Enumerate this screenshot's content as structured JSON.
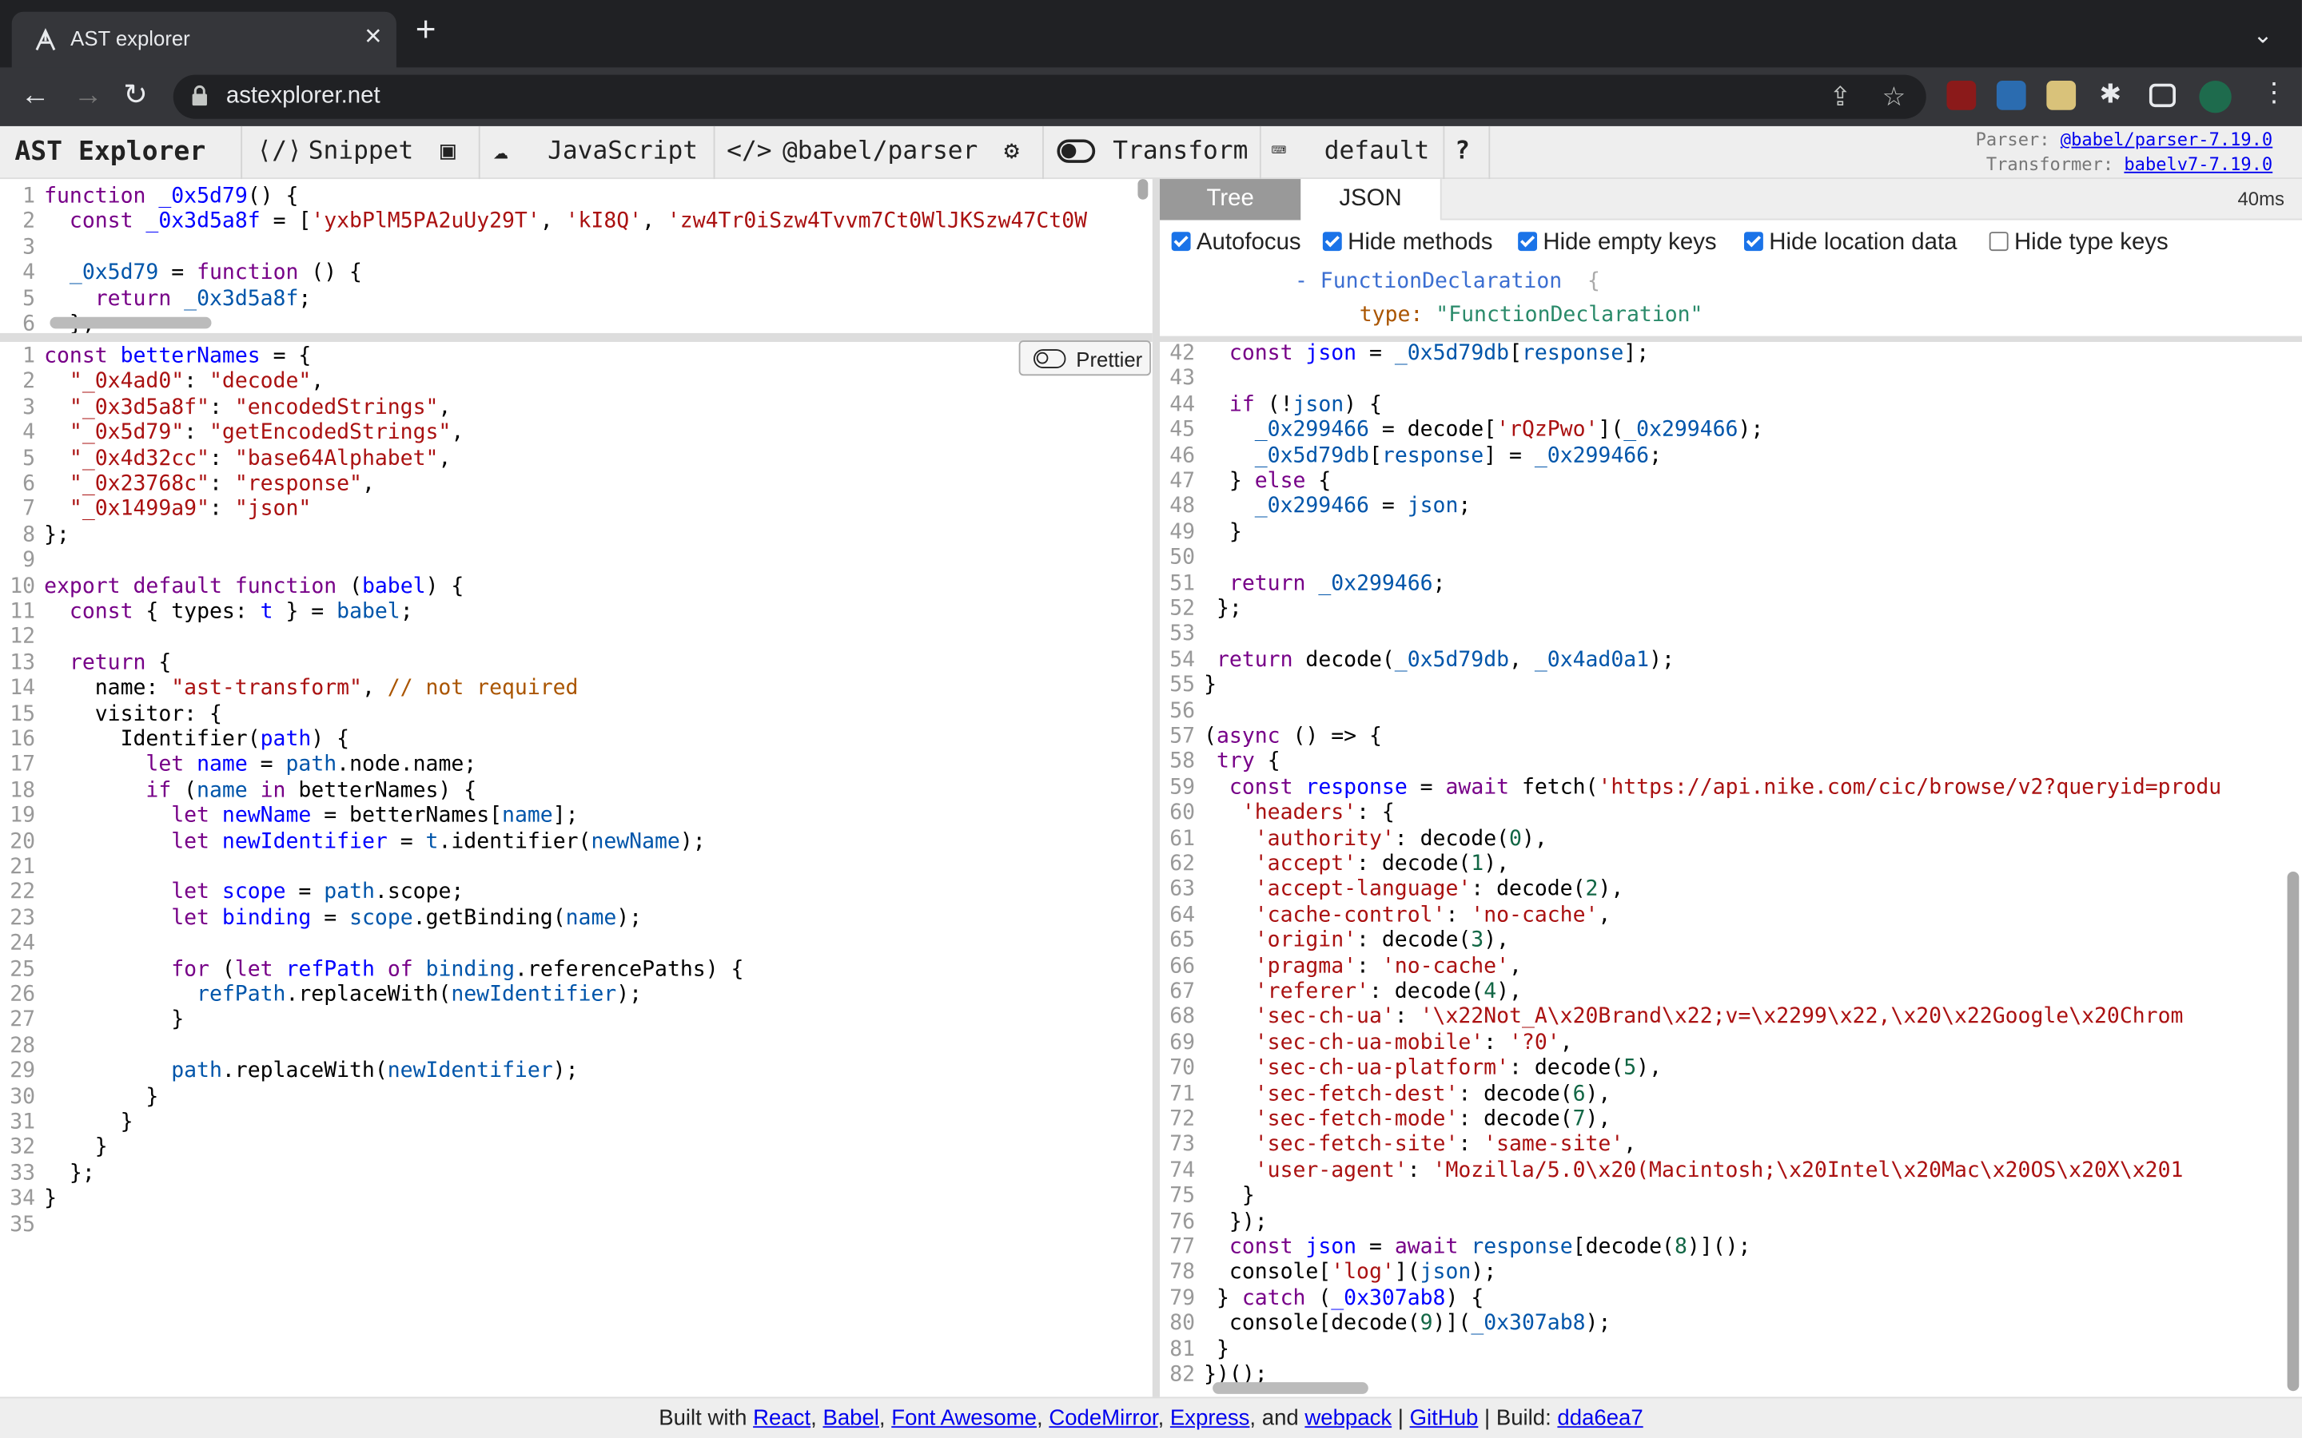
{
  "browser": {
    "tab_title": "AST explorer",
    "url": "astexplorer.net"
  },
  "toolbar": {
    "brand": "AST Explorer",
    "snippet": "Snippet",
    "language": "JavaScript",
    "parser": "@babel/parser",
    "transform": "Transform",
    "keymap": "default",
    "help": "?",
    "parser_label": "Parser:",
    "parser_version": "@babel/parser-7.19.0",
    "transformer_label": "Transformer:",
    "transformer_version": "babelv7-7.19.0"
  },
  "source_lines": [
    "<span class=\"k\">function</span> <span class=\"d\">_0x5d79</span>() {",
    "  <span class=\"k\">const</span> <span class=\"d\">_0x3d5a8f</span> = [<span class=\"s\">'yxbPlM5PA2uUy29T'</span>, <span class=\"s\">'kI8Q'</span>, <span class=\"s\">'zw4Tr0iSzw4Tvvm7Ct0WlJKSzw47Ct0W</span>",
    "",
    "  <span class=\"v\">_0x5d79</span> = <span class=\"k\">function</span> () {",
    "    <span class=\"k\">return</span> <span class=\"v\">_0x3d5a8f</span>;",
    "  };"
  ],
  "transform_lines": [
    "<span class=\"k\">const</span> <span class=\"d\">betterNames</span> = {",
    "  <span class=\"s\">\"_0x4ad0\"</span>: <span class=\"s\">\"decode\"</span>,",
    "  <span class=\"s\">\"_0x3d5a8f\"</span>: <span class=\"s\">\"encodedStrings\"</span>,",
    "  <span class=\"s\">\"_0x5d79\"</span>: <span class=\"s\">\"getEncodedStrings\"</span>,",
    "  <span class=\"s\">\"_0x4d32cc\"</span>: <span class=\"s\">\"base64Alphabet\"</span>,",
    "  <span class=\"s\">\"_0x23768c\"</span>: <span class=\"s\">\"response\"</span>,",
    "  <span class=\"s\">\"_0x1499a9\"</span>: <span class=\"s\">\"json\"</span>",
    "};",
    "",
    "<span class=\"k\">export</span> <span class=\"k\">default</span> <span class=\"k\">function</span> (<span class=\"d\">babel</span>) {",
    "  <span class=\"k\">const</span> { types: <span class=\"d\">t</span> } = <span class=\"v\">babel</span>;",
    "",
    "  <span class=\"k\">return</span> {",
    "    name: <span class=\"s\">\"ast-transform\"</span>, <span class=\"c\">// not required</span>",
    "    visitor: {",
    "      Identifier(<span class=\"d\">path</span>) {",
    "        <span class=\"k\">let</span> <span class=\"d\">name</span> = <span class=\"v\">path</span>.node.name;",
    "        <span class=\"k\">if</span> (<span class=\"v\">name</span> <span class=\"k\">in</span> betterNames) {",
    "          <span class=\"k\">let</span> <span class=\"d\">newName</span> = betterNames[<span class=\"v\">name</span>];",
    "          <span class=\"k\">let</span> <span class=\"d\">newIdentifier</span> = <span class=\"v\">t</span>.identifier(<span class=\"v\">newName</span>);",
    "",
    "          <span class=\"k\">let</span> <span class=\"d\">scope</span> = <span class=\"v\">path</span>.scope;",
    "          <span class=\"k\">let</span> <span class=\"d\">binding</span> = <span class=\"v\">scope</span>.getBinding(<span class=\"v\">name</span>);",
    "",
    "          <span class=\"k\">for</span> (<span class=\"k\">let</span> <span class=\"d\">refPath</span> <span class=\"k\">of</span> <span class=\"v\">binding</span>.referencePaths) {",
    "            <span class=\"v\">refPath</span>.replaceWith(<span class=\"v\">newIdentifier</span>);",
    "          }",
    "",
    "          <span class=\"v\">path</span>.replaceWith(<span class=\"v\">newIdentifier</span>);",
    "        }",
    "      }",
    "    }",
    "  };",
    "}",
    ""
  ],
  "output_start_line": 42,
  "output_lines": [
    "  <span class=\"k\">const</span> <span class=\"d\">json</span> = <span class=\"v\">_0x5d79db</span>[<span class=\"v\">response</span>];",
    "",
    "  <span class=\"k\">if</span> (!<span class=\"v\">json</span>) {",
    "    <span class=\"v\">_0x299466</span> = decode[<span class=\"s\">'rQzPwo'</span>](<span class=\"v\">_0x299466</span>);",
    "    <span class=\"v\">_0x5d79db</span>[<span class=\"v\">response</span>] = <span class=\"v\">_0x299466</span>;",
    "  } <span class=\"k\">else</span> {",
    "    <span class=\"v\">_0x299466</span> = <span class=\"v\">json</span>;",
    "  }",
    "",
    "  <span class=\"k\">return</span> <span class=\"v\">_0x299466</span>;",
    " };",
    "",
    " <span class=\"k\">return</span> decode(<span class=\"v\">_0x5d79db</span>, <span class=\"v\">_0x4ad0a1</span>);",
    "}",
    "",
    "(<span class=\"k\">async</span> () => {",
    " <span class=\"k\">try</span> {",
    "  <span class=\"k\">const</span> <span class=\"d\">response</span> = <span class=\"k\">await</span> fetch(<span class=\"s\">'https://api.nike.com/cic/browse/v2?queryid=produ</span>",
    "   <span class=\"s\">'headers'</span>: {",
    "    <span class=\"s\">'authority'</span>: decode(<span class=\"n\">0</span>),",
    "    <span class=\"s\">'accept'</span>: decode(<span class=\"n\">1</span>),",
    "    <span class=\"s\">'accept-language'</span>: decode(<span class=\"n\">2</span>),",
    "    <span class=\"s\">'cache-control'</span>: <span class=\"s\">'no-cache'</span>,",
    "    <span class=\"s\">'origin'</span>: decode(<span class=\"n\">3</span>),",
    "    <span class=\"s\">'pragma'</span>: <span class=\"s\">'no-cache'</span>,",
    "    <span class=\"s\">'referer'</span>: decode(<span class=\"n\">4</span>),",
    "    <span class=\"s\">'sec-ch-ua'</span>: <span class=\"s\">'\\x22Not_A\\x20Brand\\x22;v=\\x2299\\x22,\\x20\\x22Google\\x20Chrom</span>",
    "    <span class=\"s\">'sec-ch-ua-mobile'</span>: <span class=\"s\">'?0'</span>,",
    "    <span class=\"s\">'sec-ch-ua-platform'</span>: decode(<span class=\"n\">5</span>),",
    "    <span class=\"s\">'sec-fetch-dest'</span>: decode(<span class=\"n\">6</span>),",
    "    <span class=\"s\">'sec-fetch-mode'</span>: decode(<span class=\"n\">7</span>),",
    "    <span class=\"s\">'sec-fetch-site'</span>: <span class=\"s\">'same-site'</span>,",
    "    <span class=\"s\">'user-agent'</span>: <span class=\"s\">'Mozilla/5.0\\x20(Macintosh;\\x20Intel\\x20Mac\\x20OS\\x20X\\x201</span>",
    "   }",
    "  });",
    "  <span class=\"k\">const</span> <span class=\"d\">json</span> = <span class=\"k\">await</span> <span class=\"v\">response</span>[decode(<span class=\"n\">8</span>)]();",
    "  console[<span class=\"s\">'log'</span>](<span class=\"v\">json</span>);",
    " } <span class=\"k\">catch</span> (<span class=\"d\">_0x307ab8</span>) {",
    "  console[decode(<span class=\"n\">9</span>)](<span class=\"v\">_0x307ab8</span>);",
    " }",
    "})();"
  ],
  "prettier_label": "Prettier",
  "tree": {
    "tab_tree": "Tree",
    "tab_json": "JSON",
    "time": "40ms",
    "options": [
      "Autofocus",
      "Hide methods",
      "Hide empty keys",
      "Hide location data",
      "Hide type keys"
    ],
    "options_checked": [
      true,
      true,
      true,
      true,
      false
    ],
    "node_label": "- FunctionDeclaration",
    "node_brace": "{",
    "type_key": "type:",
    "type_value": "\"FunctionDeclaration\""
  },
  "footer": {
    "built_with": "Built with",
    "react": "React",
    "babel": "Babel",
    "font_awesome": "Font Awesome",
    "codemirror": "CodeMirror",
    "express": "Express",
    "and": ", and",
    "webpack": "webpack",
    "github": "GitHub",
    "build_label": "| Build:",
    "build_hash": "dda6ea7"
  }
}
